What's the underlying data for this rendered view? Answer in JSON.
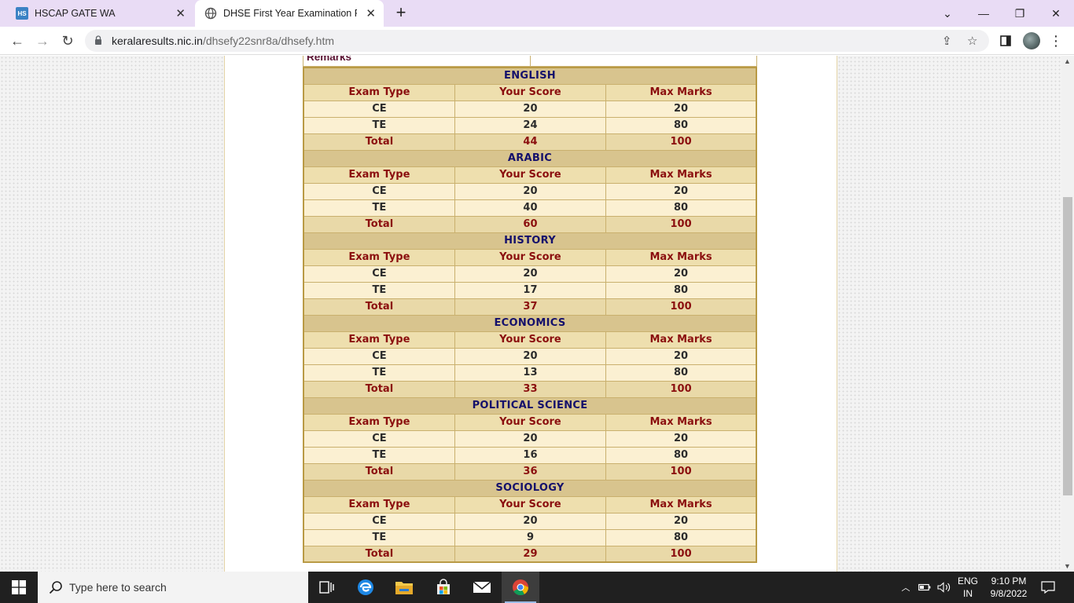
{
  "browser": {
    "tabs": [
      {
        "title": "HSCAP GATE WA",
        "favicon": "HS",
        "active": false
      },
      {
        "title": "DHSE First Year Examination Resu",
        "favicon": "globe-icon",
        "active": true
      }
    ],
    "address": {
      "domain": "keralaresults.nic.in",
      "path": "/dhsefy22snr8a/dhsefy.htm"
    }
  },
  "page": {
    "remarks_label": "Remarks",
    "headers": {
      "exam_type": "Exam Type",
      "your_score": "Your Score",
      "max_marks": "Max Marks"
    },
    "subjects": [
      {
        "name": "ENGLISH",
        "rows": [
          {
            "type": "CE",
            "score": "20",
            "max": "20"
          },
          {
            "type": "TE",
            "score": "24",
            "max": "80"
          },
          {
            "type": "Total",
            "score": "44",
            "max": "100"
          }
        ]
      },
      {
        "name": "ARABIC",
        "rows": [
          {
            "type": "CE",
            "score": "20",
            "max": "20"
          },
          {
            "type": "TE",
            "score": "40",
            "max": "80"
          },
          {
            "type": "Total",
            "score": "60",
            "max": "100"
          }
        ]
      },
      {
        "name": "HISTORY",
        "rows": [
          {
            "type": "CE",
            "score": "20",
            "max": "20"
          },
          {
            "type": "TE",
            "score": "17",
            "max": "80"
          },
          {
            "type": "Total",
            "score": "37",
            "max": "100"
          }
        ]
      },
      {
        "name": "ECONOMICS",
        "rows": [
          {
            "type": "CE",
            "score": "20",
            "max": "20"
          },
          {
            "type": "TE",
            "score": "13",
            "max": "80"
          },
          {
            "type": "Total",
            "score": "33",
            "max": "100"
          }
        ]
      },
      {
        "name": "POLITICAL SCIENCE",
        "rows": [
          {
            "type": "CE",
            "score": "20",
            "max": "20"
          },
          {
            "type": "TE",
            "score": "16",
            "max": "80"
          },
          {
            "type": "Total",
            "score": "36",
            "max": "100"
          }
        ]
      },
      {
        "name": "SOCIOLOGY",
        "rows": [
          {
            "type": "CE",
            "score": "20",
            "max": "20"
          },
          {
            "type": "TE",
            "score": "9",
            "max": "80"
          },
          {
            "type": "Total",
            "score": "29",
            "max": "100"
          }
        ]
      }
    ]
  },
  "taskbar": {
    "search_placeholder": "Type here to search",
    "language": {
      "line1": "ENG",
      "line2": "IN"
    },
    "clock": {
      "time": "9:10 PM",
      "date": "9/8/2022"
    }
  },
  "colors": {
    "subject_header_bg": "#d8c48e",
    "subject_text": "#14106b",
    "header_text": "#8b0f0f",
    "data_row_bg": "#fbf0d2"
  }
}
